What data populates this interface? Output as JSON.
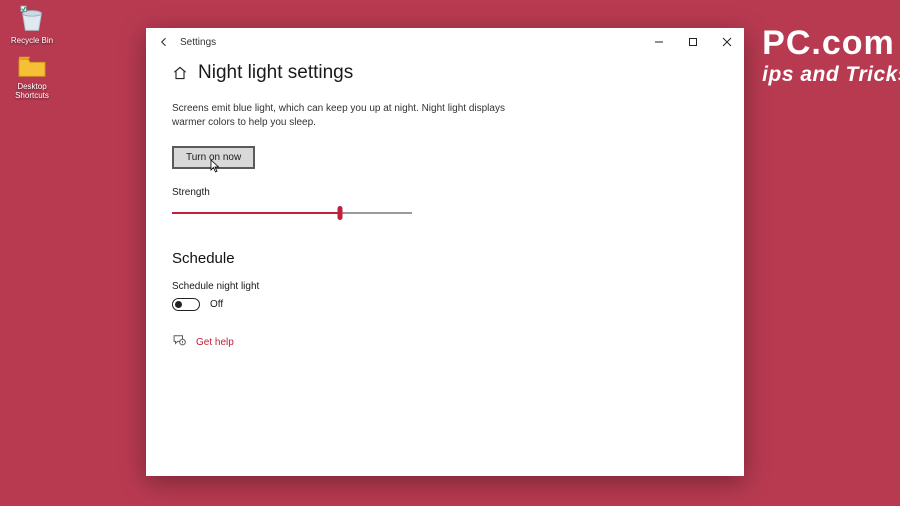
{
  "desktop": {
    "icons": [
      {
        "label": "Recycle Bin"
      },
      {
        "label": "Desktop Shortcuts"
      }
    ]
  },
  "watermark": {
    "line1": "PC.com",
    "line2": "ips and Tricks"
  },
  "window": {
    "app_title": "Settings",
    "heading": "Night light settings",
    "description": "Screens emit blue light, which can keep you up at night. Night light displays warmer colors to help you sleep.",
    "turn_on_button": "Turn on now",
    "strength_label": "Strength",
    "strength_percent": 70,
    "schedule_heading": "Schedule",
    "schedule_toggle_label": "Schedule night light",
    "schedule_toggle_state": "Off",
    "get_help": "Get help"
  },
  "colors": {
    "accent": "#C0203C",
    "desktop_bg": "#b83a51"
  }
}
